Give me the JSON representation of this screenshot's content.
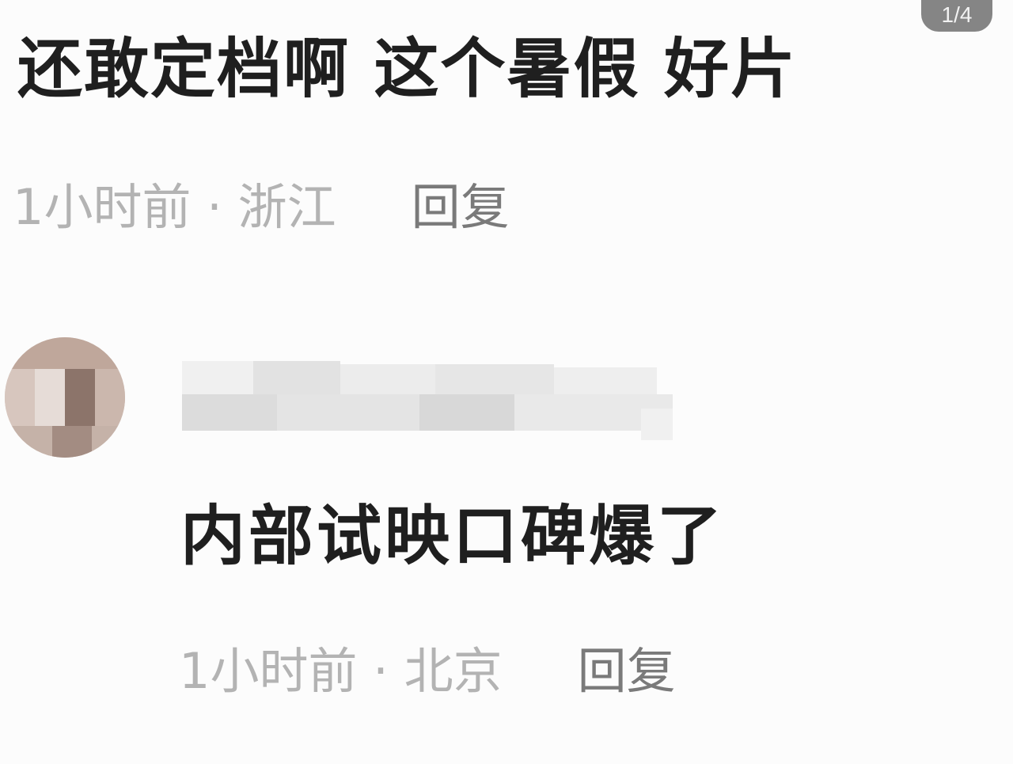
{
  "page_indicator": "1/4",
  "comments": [
    {
      "text": "还敢定档啊 这个暑假 好片",
      "time_location": "1小时前 · 浙江",
      "reply_label": "回复"
    },
    {
      "text": "内部试映口碑爆了",
      "time_location": "1小时前 · 北京",
      "reply_label": "回复"
    }
  ],
  "colors": {
    "text": "#1f1f1f",
    "meta": "#b3b3b3",
    "reply": "#7a7a7a",
    "indicator_bg": "#5a5a5a",
    "background": "#fcfcfc"
  }
}
